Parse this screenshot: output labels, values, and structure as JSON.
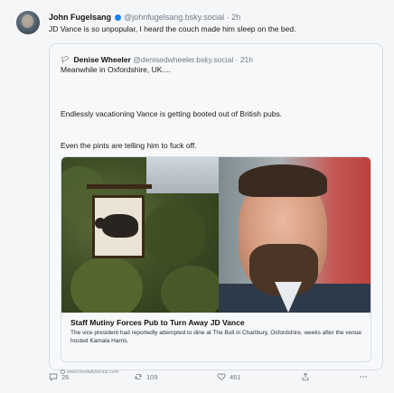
{
  "post": {
    "author": "John Fugelsang",
    "handle": "@johnfugelsang.bsky.social",
    "separator": "·",
    "time": "2h",
    "text": "JD Vance is so unpopular, I heard the couch made him sleep on the bed."
  },
  "quote": {
    "flag": "🏳",
    "author": "Denise Wheeler",
    "handle": "@denisedwheeler.bsky.social",
    "separator": "·",
    "time": "21h",
    "line2": "Meanwhile in Oxfordshire, UK....",
    "para1": "Endlessly vacationing Vance is getting booted out of British pubs.",
    "para2": "Even the pints are telling him to fuck off.",
    "card": {
      "title": "Staff Mutiny Forces Pub to Turn Away JD Vance",
      "description": "The vice president had reportedly attempted to dine at The Bull in Charlbury, Oxfordshire, weeks after the venue hosted Kamala Harris.",
      "domain": "www.thedailybeast.com"
    }
  },
  "actions": {
    "replies": "26",
    "reposts": "109",
    "likes": "461"
  },
  "colors": {
    "accent": "#1185fe",
    "muted": "#6f7a85",
    "border": "#d8dde3",
    "background": "#f5f6f8"
  }
}
